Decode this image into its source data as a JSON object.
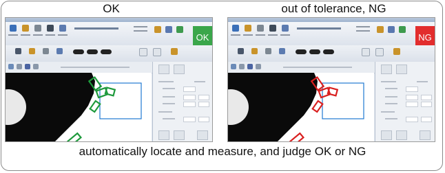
{
  "captions": {
    "left": "OK",
    "right": "out of tolerance, NG",
    "bottom": "automatically locate and measure, and judge OK or NG"
  },
  "screens": [
    {
      "status_label": "OK",
      "status_color": "#3aa64a",
      "marker_color": "#1e9a3c",
      "roi_color": "#1e78d2"
    },
    {
      "status_label": "NG",
      "status_color": "#e22d2d",
      "marker_color": "#d91f1f",
      "roi_color": "#1e78d2"
    }
  ],
  "icons": [
    "open-icon",
    "save-icon",
    "print-icon",
    "capture-icon",
    "measure-icon",
    "report-icon",
    "settings-icon"
  ]
}
